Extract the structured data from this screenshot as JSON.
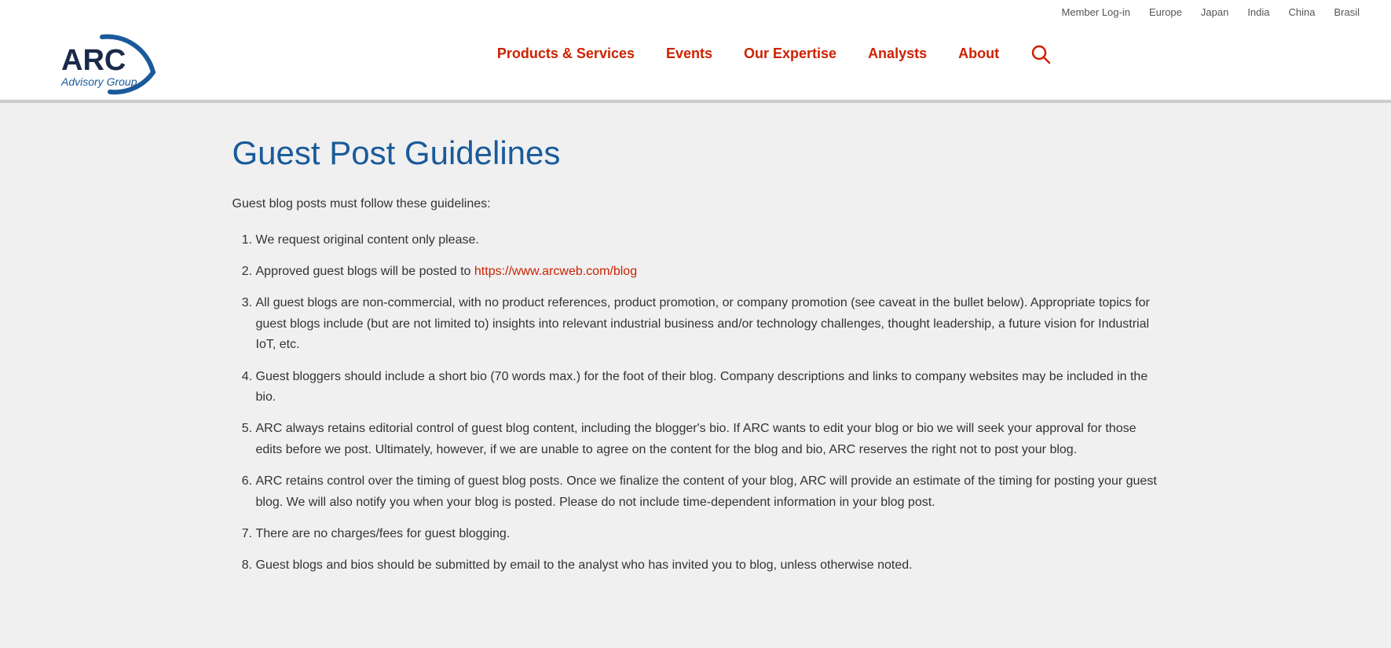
{
  "header": {
    "topLinks": [
      "Member Log-in",
      "Europe",
      "Japan",
      "India",
      "China",
      "Brasil"
    ],
    "nav": [
      {
        "label": "Products & Services",
        "id": "products-services"
      },
      {
        "label": "Events",
        "id": "events"
      },
      {
        "label": "Our Expertise",
        "id": "our-expertise"
      },
      {
        "label": "Analysts",
        "id": "analysts"
      },
      {
        "label": "About",
        "id": "about"
      }
    ]
  },
  "page": {
    "title": "Guest Post Guidelines",
    "intro": "Guest blog posts must follow these guidelines:",
    "guidelines": [
      "We request original content only please.",
      "Approved guest blogs will be posted to [link:https://www.arcweb.com/blog]",
      "All guest blogs are non-commercial, with no product references, product promotion, or company promotion (see caveat in the bullet below).  Appropriate topics for guest blogs include (but are not limited to) insights into relevant industrial business and/or technology challenges, thought leadership, a future vision for Industrial IoT, etc.",
      "Guest bloggers should include a short bio (70 words max.) for the foot of their blog.  Company descriptions and links to company websites may be included in the bio.",
      "ARC always retains editorial control of guest blog content, including the blogger's bio.  If ARC wants to edit your blog or bio we will seek your approval for those edits before we post.  Ultimately, however, if we are unable to agree on the content for the blog and bio, ARC reserves the right not to post your blog.",
      "ARC retains control over the timing of guest blog posts.  Once we finalize the content of your blog, ARC will provide an estimate of the timing for posting your guest blog.  We will also notify you when your blog is posted.  Please do not include time-dependent information in your blog post.",
      "There are no charges/fees for guest blogging.",
      "Guest blogs and bios should be submitted by email to the analyst who has invited you to blog, unless otherwise noted."
    ],
    "blogLink": "https://www.arcweb.com/blog"
  }
}
